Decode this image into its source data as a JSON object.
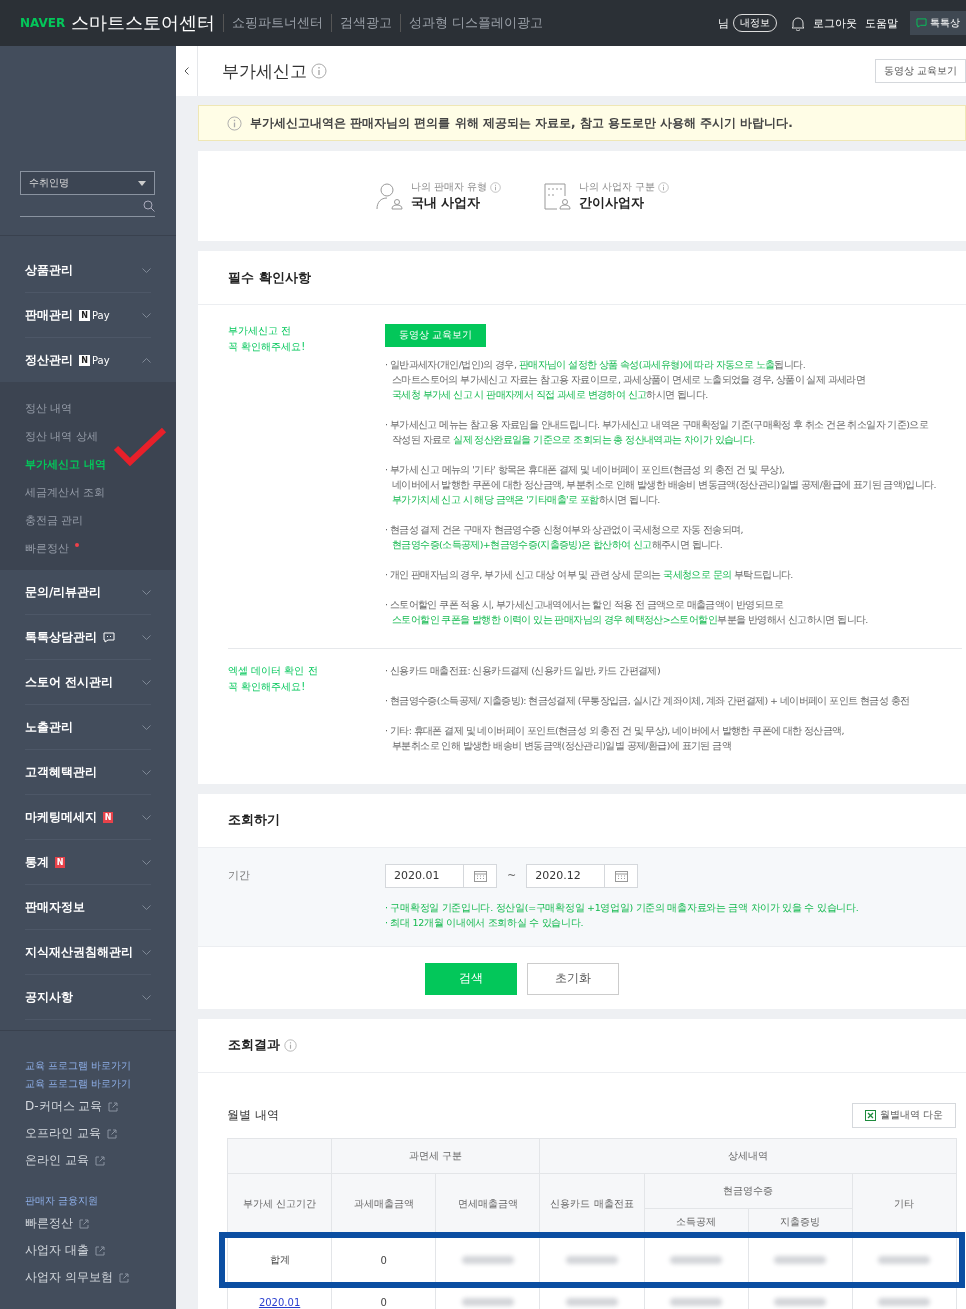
{
  "header": {
    "logo_brand": "NAVER",
    "logo_title": "스마트스토어센터",
    "links": [
      "쇼핑파트너센터",
      "검색광고",
      "성과형 디스플레이광고"
    ],
    "user_suffix": "님",
    "profile_button": "내정보",
    "logout": "로그아웃",
    "help": "도움말",
    "talk_button": "톡톡상"
  },
  "sidebar": {
    "search_select": "수취인명",
    "menu": [
      {
        "label": "상품관리",
        "expanded": false
      },
      {
        "label": "판매관리",
        "badge": {
          "kind": "npay",
          "letter": "N",
          "text": "Pay"
        },
        "expanded": false
      },
      {
        "label": "정산관리",
        "badge": {
          "kind": "npay",
          "letter": "N",
          "text": "Pay"
        },
        "expanded": true,
        "children": [
          {
            "label": "정산 내역",
            "selected": false,
            "dot": false
          },
          {
            "label": "정산 내역 상세",
            "selected": false,
            "dot": false
          },
          {
            "label": "부가세신고 내역",
            "selected": true,
            "dot": false
          },
          {
            "label": "세금계산서 조회",
            "selected": false,
            "dot": false
          },
          {
            "label": "충전금 관리",
            "selected": false,
            "dot": false
          },
          {
            "label": "빠른정산",
            "selected": false,
            "dot": true
          }
        ]
      },
      {
        "label": "문의/리뷰관리",
        "expanded": false
      },
      {
        "label": "톡톡상담관리",
        "badge": {
          "kind": "talk"
        },
        "expanded": false
      },
      {
        "label": "스토어 전시관리",
        "expanded": false
      },
      {
        "label": "노출관리",
        "expanded": false
      },
      {
        "label": "고객혜택관리",
        "expanded": false
      },
      {
        "label": "마케팅메세지",
        "badge": {
          "kind": "new",
          "text": "N"
        },
        "expanded": false
      },
      {
        "label": "통계",
        "badge": {
          "kind": "new",
          "text": "N"
        },
        "expanded": false
      },
      {
        "label": "판매자정보",
        "expanded": false
      },
      {
        "label": "지식재산권침해관리",
        "expanded": false
      },
      {
        "label": "공지사항",
        "expanded": false
      }
    ],
    "link_groups": [
      {
        "titles": [
          "교육 프로그램 바로가기",
          "교육 프로그램 바로가기"
        ],
        "links": [
          "D-커머스 교육",
          "오프라인 교육",
          "온라인 교육"
        ]
      },
      {
        "titles": [
          "판매자 금융지원"
        ],
        "links": [
          "빠른정산",
          "사업자 대출",
          "사업자 의무보험"
        ]
      }
    ]
  },
  "page": {
    "title": "부가세신고",
    "video_button": "동영상 교육보기",
    "notice": "부가세신고내역은 판매자님의 편의를 위해 제공되는 자료로, 참고 용도로만 사용해 주시기 바랍니다.",
    "seller_info": [
      {
        "kind": "person",
        "label": "나의 판매자 유형",
        "value": "국내 사업자"
      },
      {
        "kind": "building",
        "label": "나의 사업자 구분",
        "value": "간이사업자"
      }
    ]
  },
  "required": {
    "title": "필수 확인사항",
    "sections": [
      {
        "label": [
          "부가세신고 전",
          "꼭 확인해주세요!"
        ],
        "marker": "·",
        "button": "동영상 교육보기",
        "bullets": [
          {
            "lines": [
              [
                {
                  "text": "일반과세자(개인/법인)의 경우, ",
                  "highlight": false
                },
                {
                  "text": "판매자님이 설정한 상품 속성(과세유형)에 따라 자동으로 노출",
                  "highlight": true
                },
                {
                  "text": "됩니다.",
                  "highlight": false
                }
              ],
              [
                {
                  "text": "스마트스토어의 부가세신고 자료는 참고용 자료이므로, 과세상품이 면세로 노출되었을 경우, 상품이 실제 과세라면",
                  "highlight": false
                }
              ],
              [
                {
                  "text": "국세청 부가세 신고 시 판매자께서 직접 과세로 변경하여 신고",
                  "highlight": true
                },
                {
                  "text": "하시면 됩니다.",
                  "highlight": false
                }
              ]
            ]
          },
          {
            "lines": [
              [
                {
                  "text": "부가세신고 메뉴는 참고용 자료임을 안내드립니다. 부가세신고 내역은 구매확정일 기준(구매확정 후 취소 건은 취소일자 기준)으로",
                  "highlight": false
                }
              ],
              [
                {
                  "text": "작성된 자료로 ",
                  "highlight": false
                },
                {
                  "text": "실제 정산완료일을 기준으로 조회되는 총 정산내역과는 차이가 있습니다.",
                  "highlight": true
                }
              ]
            ]
          },
          {
            "lines": [
              [
                {
                  "text": "부가세 신고 메뉴의 '기타' 항목은 휴대폰 결제 및 네이버페이 포인트(현금성 외 충전 건 및 무상),",
                  "highlight": false
                }
              ],
              [
                {
                  "text": "네이버에서 발행한 쿠폰에 대한 정산금액, 부분취소로 인해 발생한 배송비 변동금액(정산관리)일별 공제/환급에 표기된 금액)입니다.",
                  "highlight": false
                }
              ],
              [
                {
                  "text": "부가가치세 신고 시 해당 금액은 '기타매출'로 포함",
                  "highlight": true
                },
                {
                  "text": "하시면 됩니다.",
                  "highlight": false
                }
              ]
            ]
          },
          {
            "lines": [
              [
                {
                  "text": "현금성 결제 건은 구매자 현금영수증 신청여부와 상관없이 국세청으로 자동 전송되며,",
                  "highlight": false
                }
              ],
              [
                {
                  "text": "현금영수증(소득공제)+현금영수증(지출증빙)은 합산하여 신고",
                  "highlight": true
                },
                {
                  "text": "해주시면 됩니다.",
                  "highlight": false
                }
              ]
            ]
          },
          {
            "lines": [
              [
                {
                  "text": "개인 판매자님의 경우, 부가세 신고 대상 여부 및 관련 상세 문의는 ",
                  "highlight": false
                },
                {
                  "text": "국세청으로 문의",
                  "highlight": true
                },
                {
                  "text": " 부탁드립니다.",
                  "highlight": false
                }
              ]
            ]
          },
          {
            "lines": [
              [
                {
                  "text": "스토어할인 쿠폰 적용 시, 부가세신고내역에서는 할인 적용 전 금액으로 매출금액이 반영되므로",
                  "highlight": false
                }
              ],
              [
                {
                  "text": "스토어할인 쿠폰을 발행한 이력이 있는 판매자님의 경우 혜택정산>스토어할인",
                  "highlight": true
                },
                {
                  "text": "부분을 반영해서 신고하시면 됩니다.",
                  "highlight": false
                }
              ]
            ]
          }
        ]
      },
      {
        "label": [
          "엑셀 데이터 확인 전",
          "꼭 확인해주세요!"
        ],
        "marker": "·",
        "bullets": [
          {
            "lines": [
              [
                {
                  "text": "신용카드 매출전표: 신용카드결제 (신용카드 일반, 카드 간편결제)",
                  "highlight": false
                }
              ]
            ]
          },
          {
            "lines": [
              [
                {
                  "text": "현금영수증(소득공제/ 지출증빙): 현금성결제 (무통장입금, 실시간 계좌이체, 계좌 간편결제) + 네이버페이 포인트 현금성 충전",
                  "highlight": false
                }
              ]
            ]
          },
          {
            "lines": [
              [
                {
                  "text": "기타: 휴대폰 결제 및 네이버페이 포인트(현금성 외 충전 건 및 무상), 네이버에서 발행한 쿠폰에 대한 정산금액,",
                  "highlight": false
                }
              ],
              [
                {
                  "text": "부분취소로 인해 발생한 배송비 변동금액(정산관리)일별 공제/환급)에 표기된 금액",
                  "highlight": false
                }
              ]
            ]
          }
        ]
      }
    ]
  },
  "query": {
    "title": "조회하기",
    "period_label": "기간",
    "from": "2020.01",
    "separator": "~",
    "to": "2020.12",
    "hints": [
      {
        "marker": "·",
        "text": "구매확정일 기준입니다. 정산일(=구매확정일 +1영업일) 기준의 매출자료와는 금액 차이가 있을 수 있습니다."
      },
      {
        "marker": "·",
        "text": "최대 12개월 이내에서 조회하실 수 있습니다."
      }
    ],
    "search_button": "검색",
    "reset_button": "초기화"
  },
  "results": {
    "title": "조회결과",
    "subtitle": "월별 내역",
    "download_button": "월별내역 다운",
    "table": {
      "period": "부가세 신고기간",
      "group_tax": "과면세 구분",
      "taxable": "과세매출금액",
      "exempt": "면세매출금액",
      "group_detail": "상세내역",
      "card": "신용카드 매출전표",
      "cash_group": "현금영수증",
      "income": "소득공제",
      "expense": "지출증빙",
      "other": "기타",
      "rows": [
        {
          "kind": "total",
          "cells": [
            {
              "text": "합계",
              "blurred": false
            },
            {
              "text": "0",
              "blurred": false
            },
            {
              "blurred": true
            },
            {
              "blurred": true
            },
            {
              "blurred": true
            },
            {
              "blurred": true
            },
            {
              "blurred": true
            }
          ]
        },
        {
          "kind": "month",
          "cells": [
            {
              "text": "2020.01",
              "blurred": false
            },
            {
              "text": "0",
              "blurred": false
            },
            {
              "blurred": true
            },
            {
              "blurred": true
            },
            {
              "blurred": true
            },
            {
              "blurred": true
            },
            {
              "blurred": true
            }
          ]
        }
      ]
    }
  },
  "annotations": {
    "check_mark": true,
    "highlight_total_row": true
  }
}
